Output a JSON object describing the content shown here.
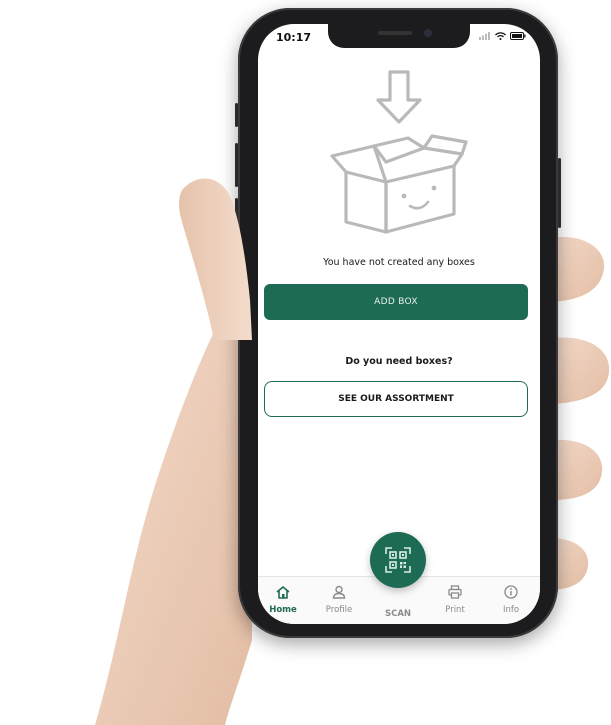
{
  "status_bar": {
    "time": "10:17"
  },
  "main": {
    "illustration_icon": "empty-box-with-down-arrow",
    "empty_message": "You have not created any boxes",
    "add_box_label": "ADD BOX",
    "need_boxes_message": "Do you need boxes?",
    "assortment_label": "SEE OUR ASSORTMENT"
  },
  "tabbar": {
    "items": [
      {
        "label": "Home",
        "icon": "home-icon",
        "active": true
      },
      {
        "label": "Profile",
        "icon": "user-icon",
        "active": false
      },
      {
        "label": "SCAN",
        "icon": "qr-code-icon",
        "active": false
      },
      {
        "label": "Print",
        "icon": "printer-icon",
        "active": false
      },
      {
        "label": "Info",
        "icon": "info-icon",
        "active": false
      }
    ]
  },
  "colors": {
    "brand_green": "#1e6b55",
    "illustration_gray": "#b9b9b9",
    "inactive_tab": "#8a8a8a"
  }
}
